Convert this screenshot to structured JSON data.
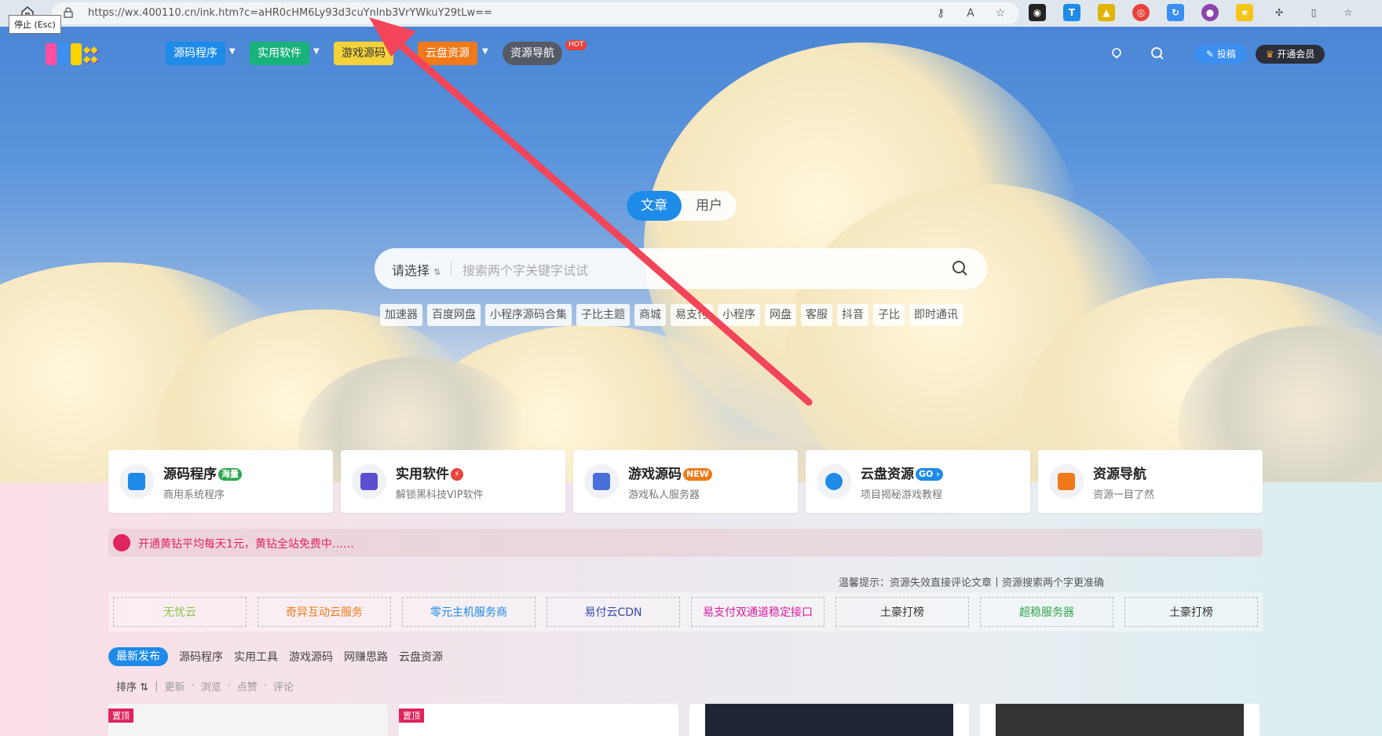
{
  "browser": {
    "url": "https://wx.400110.cn/ink.htm?c=aHR0cHM6Ly93d3cuYnlnb3VrYWkuY29tLw==",
    "tooltip": "停止 (Esc)"
  },
  "nav": {
    "items": [
      {
        "label": "源码程序",
        "color": "#1e8be8"
      },
      {
        "label": "实用软件",
        "color": "#18b27a"
      },
      {
        "label": "游戏源码",
        "color": "#f5d23a"
      },
      {
        "label": "云盘资源",
        "color": "#f07a1a"
      },
      {
        "label": "资源导航",
        "color": "#555b66"
      }
    ],
    "hot_badge": "HOT",
    "contribute_label": "投稿",
    "vip_label": "开通会员"
  },
  "search": {
    "tabs": [
      "文章",
      "用户"
    ],
    "select_label": "请选择",
    "placeholder": "搜索两个字关键字试试",
    "tags": [
      "加速器",
      "百度网盘",
      "小程序源码合集",
      "子比主题",
      "商城",
      "易支付",
      "小程序",
      "网盘",
      "客服",
      "抖音",
      "子比",
      "即时通讯"
    ]
  },
  "cards": [
    {
      "title": "源码程序",
      "badge": "海量",
      "badge_color": "#2fa84f",
      "sub": "商用系统程序",
      "icon": "code-icon",
      "icon_color": "#1e8be8"
    },
    {
      "title": "实用软件",
      "badge": "⚡",
      "badge_color": "#e8423b",
      "sub": "解锁黑科技VIP软件",
      "icon": "apps-icon",
      "icon_color": "#5b4fcf"
    },
    {
      "title": "游戏源码",
      "badge": "NEW",
      "badge_color": "#f07a1a",
      "sub": "游戏私人服务器",
      "icon": "gamepad-icon",
      "icon_color": "#4a6fd8"
    },
    {
      "title": "云盘资源",
      "badge": "GO ›",
      "badge_color": "#1e8be8",
      "sub": "项目揭秘游戏教程",
      "icon": "cloud-icon",
      "icon_color": "#1e8be8"
    },
    {
      "title": "资源导航",
      "badge": "",
      "badge_color": "",
      "sub": "资源一目了然",
      "icon": "signpost-icon",
      "icon_color": "#f07a1a"
    }
  ],
  "notice": "开通黄钻平均每天1元，黄钻全站免费中……",
  "tip": "温馨提示：资源失效直接评论文章丨资源搜索两个字更准确",
  "links": [
    {
      "label": "无忧云",
      "color": "#8bc34a"
    },
    {
      "label": "奇异互动云服务",
      "color": "#f07a1a"
    },
    {
      "label": "零元主机服务商",
      "color": "#1e8be8"
    },
    {
      "label": "易付云CDN",
      "color": "#3949ab"
    },
    {
      "label": "易支付双通道稳定接口",
      "color": "#d81b9b"
    },
    {
      "label": "土豪打榜",
      "color": "#333333"
    },
    {
      "label": "超稳服务器",
      "color": "#2fa84f"
    },
    {
      "label": "土豪打榜",
      "color": "#333333"
    }
  ],
  "content_tabs": [
    "最新发布",
    "源码程序",
    "实用工具",
    "游戏源码",
    "网赚思路",
    "云盘资源"
  ],
  "sort": {
    "label": "排序",
    "options": [
      "更新",
      "浏览",
      "点赞",
      "评论"
    ]
  },
  "thumbs": [
    {
      "pin": "置顶"
    },
    {
      "pin": "置顶"
    },
    {
      "pin": ""
    },
    {
      "pin": ""
    }
  ]
}
